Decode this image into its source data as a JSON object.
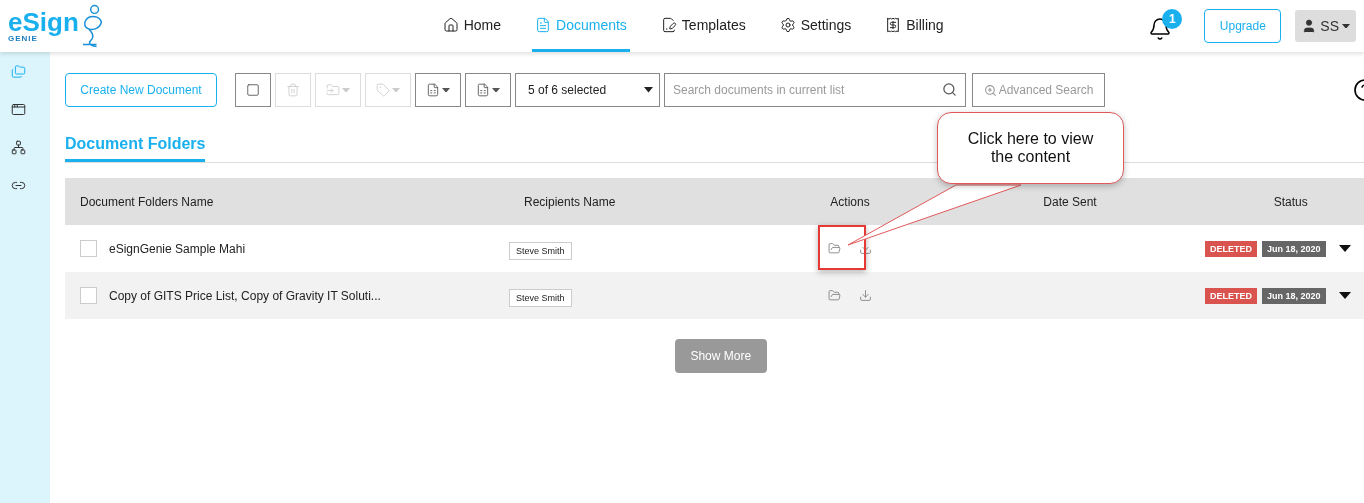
{
  "brand": {
    "logo_text": "eSign",
    "logo_subtext": "GENIE"
  },
  "nav": [
    {
      "label": "Home",
      "kind": "home",
      "selected": false
    },
    {
      "label": "Documents",
      "kind": "documents",
      "selected": true
    },
    {
      "label": "Templates",
      "kind": "templates",
      "selected": false
    },
    {
      "label": "Settings",
      "kind": "settings",
      "selected": false
    },
    {
      "label": "Billing",
      "kind": "billing",
      "selected": false
    }
  ],
  "notifications": {
    "count": "1"
  },
  "upgrade_button": "Upgrade",
  "user_menu": {
    "initials": "SS"
  },
  "sidebar": [
    {
      "kind": "folders",
      "selected": true
    },
    {
      "kind": "window",
      "selected": false
    },
    {
      "kind": "tree",
      "selected": false
    },
    {
      "kind": "link",
      "selected": false
    }
  ],
  "toolbar": {
    "create_button": "Create New Document",
    "tools": [
      {
        "kind": "checkbox",
        "disabled": false,
        "dropdown": false
      },
      {
        "kind": "trash",
        "disabled": true,
        "dropdown": false
      },
      {
        "kind": "move",
        "disabled": true,
        "dropdown": true
      },
      {
        "kind": "tag",
        "disabled": true,
        "dropdown": true
      },
      {
        "kind": "export",
        "disabled": false,
        "dropdown": true
      },
      {
        "kind": "file",
        "disabled": false,
        "dropdown": true
      }
    ],
    "selection": "5 of 6 selected",
    "search": {
      "placeholder": "Search documents in current list"
    },
    "advanced_search": "Advanced Search"
  },
  "section_tab": {
    "label": "Document Folders",
    "selected": true
  },
  "table": {
    "columns": [
      "Document Folders Name",
      "Recipients Name",
      "Actions",
      "Date Sent",
      "Status"
    ],
    "rows": [
      {
        "name": "eSignGenie Sample Mahi",
        "checked": false,
        "recipients": [
          "Steve Smith"
        ],
        "highlighted": true,
        "status": "DELETED",
        "date": "Jun 18, 2020"
      },
      {
        "name": "Copy of GITS Price List, Copy of Gravity IT Soluti...",
        "checked": false,
        "recipients": [
          "Steve Smith"
        ],
        "highlighted": false,
        "status": "DELETED",
        "date": "Jun 18, 2020"
      }
    ]
  },
  "show_more": "Show More",
  "callout": {
    "text": "Click here to view the content"
  }
}
